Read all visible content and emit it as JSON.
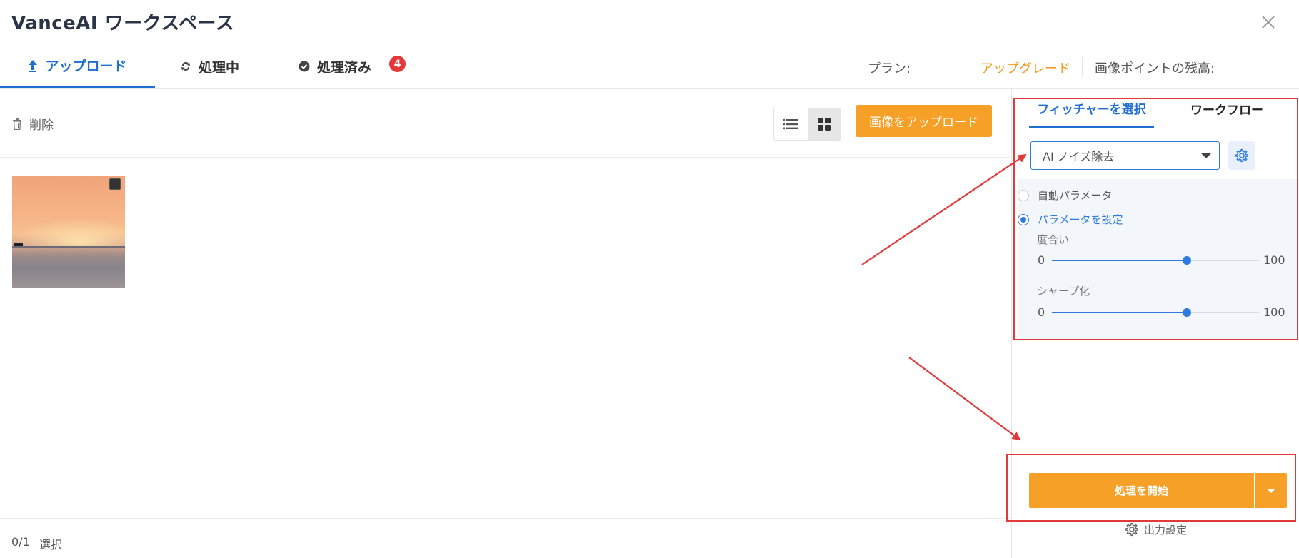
{
  "app": {
    "title": "VanceAI ワークスペース"
  },
  "tabs": [
    {
      "label": "アップロード",
      "icon": "upload-arrow-icon",
      "active": true
    },
    {
      "label": "処理中",
      "icon": "refresh-icon",
      "active": false
    },
    {
      "label": "処理済み",
      "icon": "check-circle-icon",
      "active": false,
      "badge": "4"
    }
  ],
  "account": {
    "plan_label": "プラン:",
    "upgrade_label": "アップグレード",
    "points_label": "画像ポイントの残高:"
  },
  "toolbar": {
    "delete_label": "削除",
    "upload_label": "画像をアップロード",
    "view_modes": [
      "list",
      "grid"
    ],
    "active_view": "grid"
  },
  "images": [
    {
      "name": "sunset-sea",
      "selected": false
    }
  ],
  "footer": {
    "selection_count": "0/1",
    "selection_label": "選択"
  },
  "panel": {
    "tabs": [
      {
        "label": "フィッチャーを選択",
        "active": true
      },
      {
        "label": "ワークフロー",
        "active": false
      }
    ],
    "feature": {
      "selected": "AI ノイズ除去"
    },
    "modes": [
      {
        "label": "自動パラメータ",
        "selected": false
      },
      {
        "label": "パラメータを設定",
        "selected": true
      }
    ],
    "sliders": [
      {
        "label": "度合い",
        "min": "0",
        "max": "100",
        "value": 65
      },
      {
        "label": "シャープ化",
        "min": "0",
        "max": "100",
        "value": 65
      }
    ],
    "start_label": "処理を開始",
    "output_settings_label": "出力設定"
  },
  "colors": {
    "accent_blue": "#1f6fd0",
    "accent_orange": "#f7a027",
    "badge_red": "#e5373a",
    "annotation_red": "#e03a3a"
  }
}
